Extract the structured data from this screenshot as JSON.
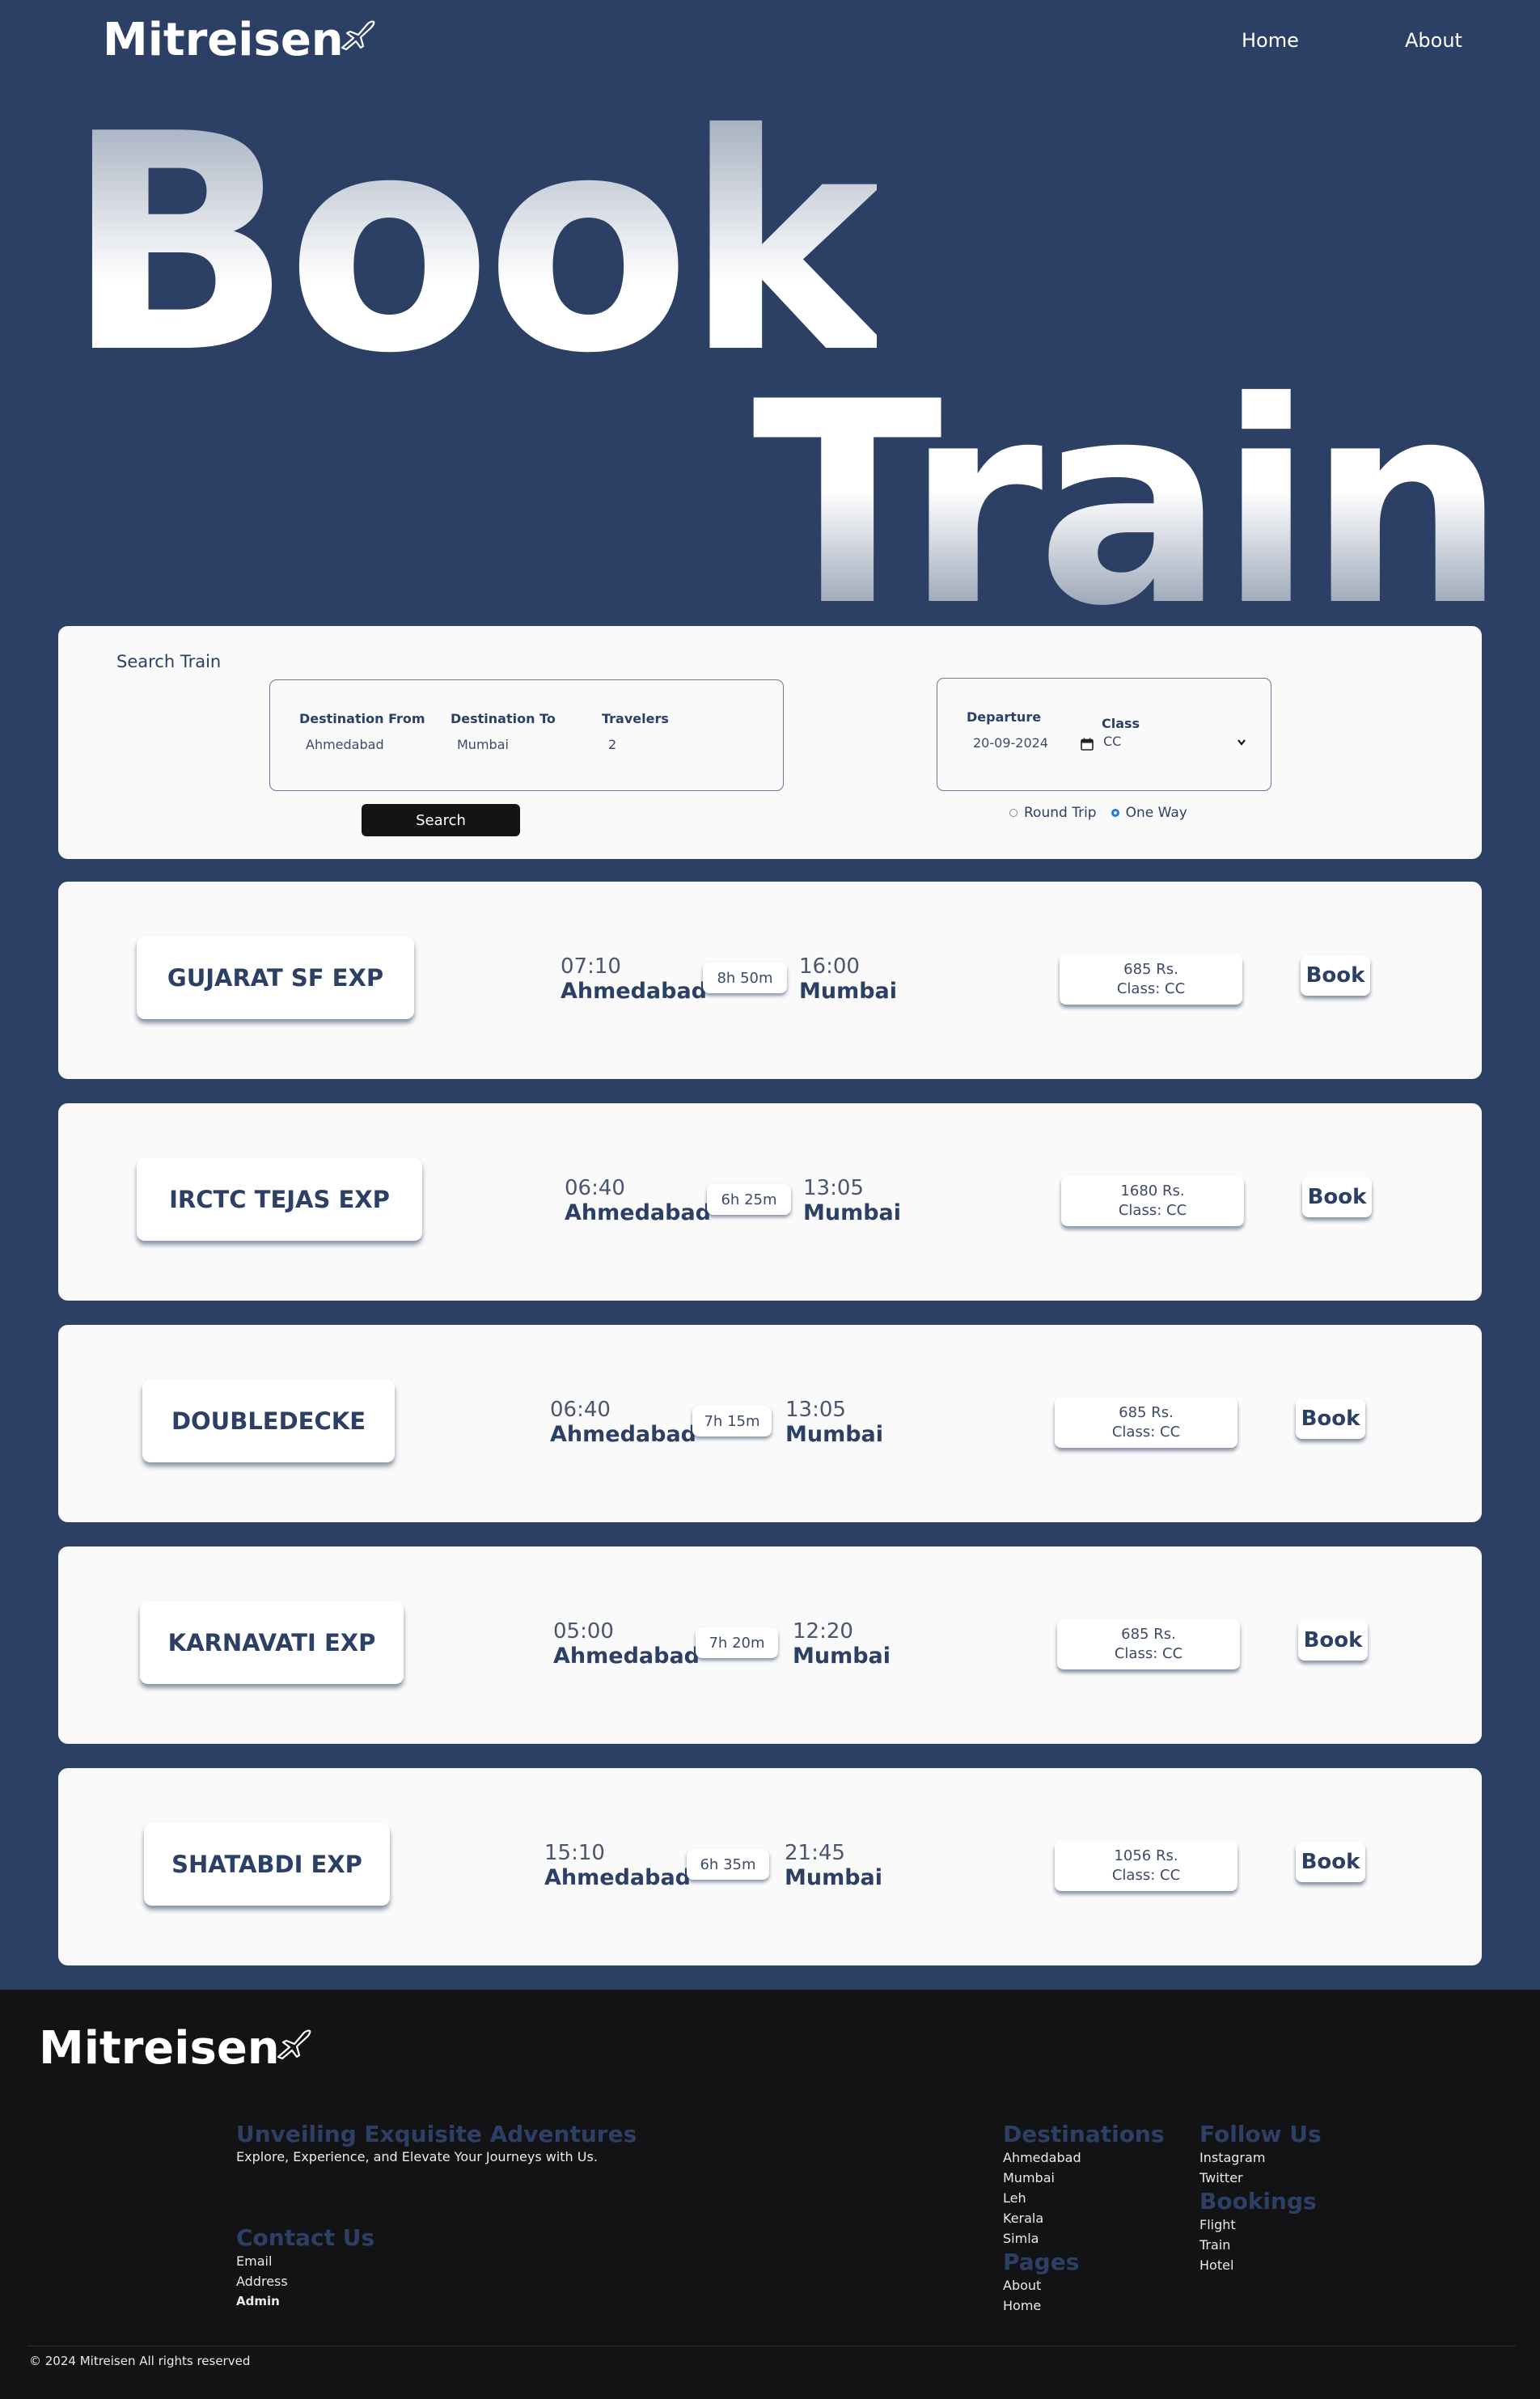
{
  "header": {
    "logo_text": "Mitreisen",
    "nav": [
      "Home",
      "About"
    ]
  },
  "hero": {
    "line1": "Book",
    "line2": "Train"
  },
  "search": {
    "title": "Search Train",
    "from_label": "Destination From",
    "from_value": "Ahmedabad",
    "to_label": "Destination To",
    "to_value": "Mumbai",
    "travelers_label": "Travelers",
    "travelers_value": "2",
    "departure_label": "Departure",
    "departure_value": "20-09-2024",
    "class_label": "Class",
    "class_value": "CC",
    "button": "Search",
    "trip_options": [
      "Round Trip",
      "One Way"
    ],
    "selected_trip": "One Way"
  },
  "trains": [
    {
      "name": "GUJARAT SF EXP",
      "dep_time": "07:10",
      "from": "Ahmedabad",
      "duration": "8h 50m",
      "arr_time": "16:00",
      "to": "Mumbai",
      "price": "685 Rs.",
      "class": "Class: CC",
      "book": "Book"
    },
    {
      "name": "IRCTC TEJAS EXP",
      "dep_time": "06:40",
      "from": "Ahmedabad",
      "duration": "6h 25m",
      "arr_time": "13:05",
      "to": "Mumbai",
      "price": "1680 Rs.",
      "class": "Class: CC",
      "book": "Book"
    },
    {
      "name": "DOUBLEDECKE",
      "dep_time": "06:40",
      "from": "Ahmedabad",
      "duration": "7h 15m",
      "arr_time": "13:05",
      "to": "Mumbai",
      "price": "685 Rs.",
      "class": "Class: CC",
      "book": "Book"
    },
    {
      "name": "KARNAVATI EXP",
      "dep_time": "05:00",
      "from": "Ahmedabad",
      "duration": "7h 20m",
      "arr_time": "12:20",
      "to": "Mumbai",
      "price": "685 Rs.",
      "class": "Class: CC",
      "book": "Book"
    },
    {
      "name": "SHATABDI EXP",
      "dep_time": "15:10",
      "from": "Ahmedabad",
      "duration": "6h 35m",
      "arr_time": "21:45",
      "to": "Mumbai",
      "price": "1056 Rs.",
      "class": "Class: CC",
      "book": "Book"
    }
  ],
  "footer": {
    "logo_text": "Mitreisen",
    "tagline_title": "Unveiling Exquisite Adventures",
    "tagline_text": "Explore, Experience, and Elevate Your Journeys with Us.",
    "contact_title": "Contact Us",
    "contact_links": [
      "Email",
      "Address",
      "Admin"
    ],
    "destinations_title": "Destinations",
    "destinations": [
      "Ahmedabad",
      "Mumbai",
      "Leh",
      "Kerala",
      "Simla"
    ],
    "pages_title": "Pages",
    "pages": [
      "About",
      "Home"
    ],
    "follow_title": "Follow Us",
    "follow": [
      "Instagram",
      "Twitter"
    ],
    "bookings_title": "Bookings",
    "bookings": [
      "Flight",
      "Train",
      "Hotel"
    ],
    "copyright": "© 2024 Mitreisen All rights reserved"
  },
  "colors": {
    "page_bg": "#2c4066",
    "card_bg": "#fafafa",
    "footer_bg": "#131315",
    "accent": "#2c4066"
  }
}
